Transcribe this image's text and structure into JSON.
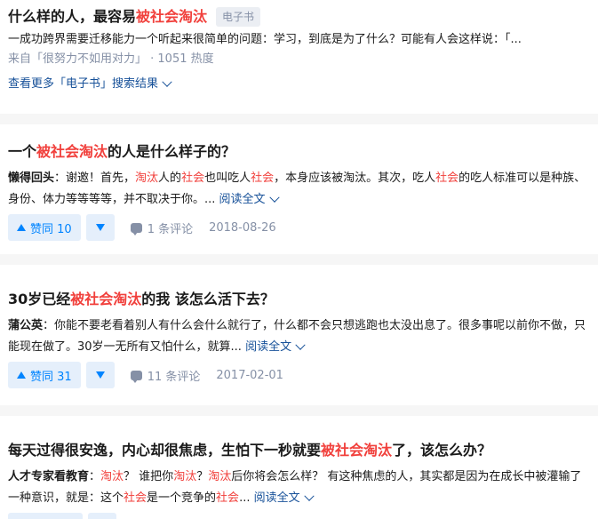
{
  "ebook_card": {
    "title_prefix": "什么样的人，最容易",
    "title_highlight": "被社会淘汰",
    "tag": "电子书",
    "excerpt": "一成功跨界需要迁移能力一个听起来很简单的问题：学习，到底是为了什么？可能有人会这样说：「...",
    "source": "来自「很努力不如用对力」 · 1051 热度",
    "more_link": "查看更多「电子书」搜索结果"
  },
  "questions": [
    {
      "title_parts": [
        {
          "text": "一个",
          "hl": false
        },
        {
          "text": "被社会淘汰",
          "hl": true
        },
        {
          "text": "的人是什么样子的？",
          "hl": false
        }
      ],
      "author": "懒得回头",
      "excerpt_parts": [
        {
          "text": "：谢邀！首先，",
          "hl": false
        },
        {
          "text": "淘汰",
          "hl": true
        },
        {
          "text": "人的",
          "hl": false
        },
        {
          "text": "社会",
          "hl": true
        },
        {
          "text": "也叫吃人",
          "hl": false
        },
        {
          "text": "社会",
          "hl": true
        },
        {
          "text": "，本身应该被淘汰。其次，吃人",
          "hl": false
        },
        {
          "text": "社会",
          "hl": true
        },
        {
          "text": "的吃人标准可以是种族、身份、体力等等等等，并不取决于你。...",
          "hl": false
        }
      ],
      "read_full": "阅读全文",
      "vote_label": "赞同 10",
      "comment_label": "1 条评论",
      "date": "2018-08-26"
    },
    {
      "title_parts": [
        {
          "text": "30岁已经",
          "hl": false
        },
        {
          "text": "被社会淘汰",
          "hl": true
        },
        {
          "text": "的我 该怎么活下去？",
          "hl": false
        }
      ],
      "author": "蒲公英",
      "excerpt_parts": [
        {
          "text": "：你能不要老看着别人有什么会什么就行了，什么都不会只想逃跑也太没出息了。很多事呢以前你不做，只能现在做了。30岁一无所有又怕什么，就算...",
          "hl": false
        }
      ],
      "read_full": "阅读全文",
      "vote_label": "赞同 31",
      "comment_label": "11 条评论",
      "date": "2017-02-01"
    },
    {
      "title_parts": [
        {
          "text": "每天过得很安逸，内心却很焦虑，生怕下一秒就要",
          "hl": false
        },
        {
          "text": "被社会淘汰",
          "hl": true
        },
        {
          "text": "了，该怎么办？",
          "hl": false
        }
      ],
      "author": "人才专家看教育",
      "excerpt_parts": [
        {
          "text": "：",
          "hl": false
        },
        {
          "text": "淘汰",
          "hl": true
        },
        {
          "text": "？ 谁把你",
          "hl": false
        },
        {
          "text": "淘汰",
          "hl": true
        },
        {
          "text": "？",
          "hl": false
        },
        {
          "text": "淘汰",
          "hl": true
        },
        {
          "text": "后你将会怎么样？ 有这种焦虑的人，其实都是因为在成长中被灌输了一种意识，就是：这个",
          "hl": false
        },
        {
          "text": "社会",
          "hl": true
        },
        {
          "text": "是一个竞争的",
          "hl": false
        },
        {
          "text": "社会",
          "hl": true
        },
        {
          "text": "...",
          "hl": false
        }
      ],
      "read_full": "阅读全文",
      "vote_label": "",
      "comment_label": "",
      "date": ""
    }
  ],
  "icons": {
    "vote_up": "triangle-up-icon",
    "vote_down": "triangle-down-icon",
    "comment": "comment-bubble-icon",
    "expand": "chevron-down-icon"
  },
  "colors": {
    "highlight": "#f1403c",
    "link": "#175199",
    "vote": "#0084ff",
    "vote_bg": "#e5effb",
    "muted": "#8590a6"
  }
}
